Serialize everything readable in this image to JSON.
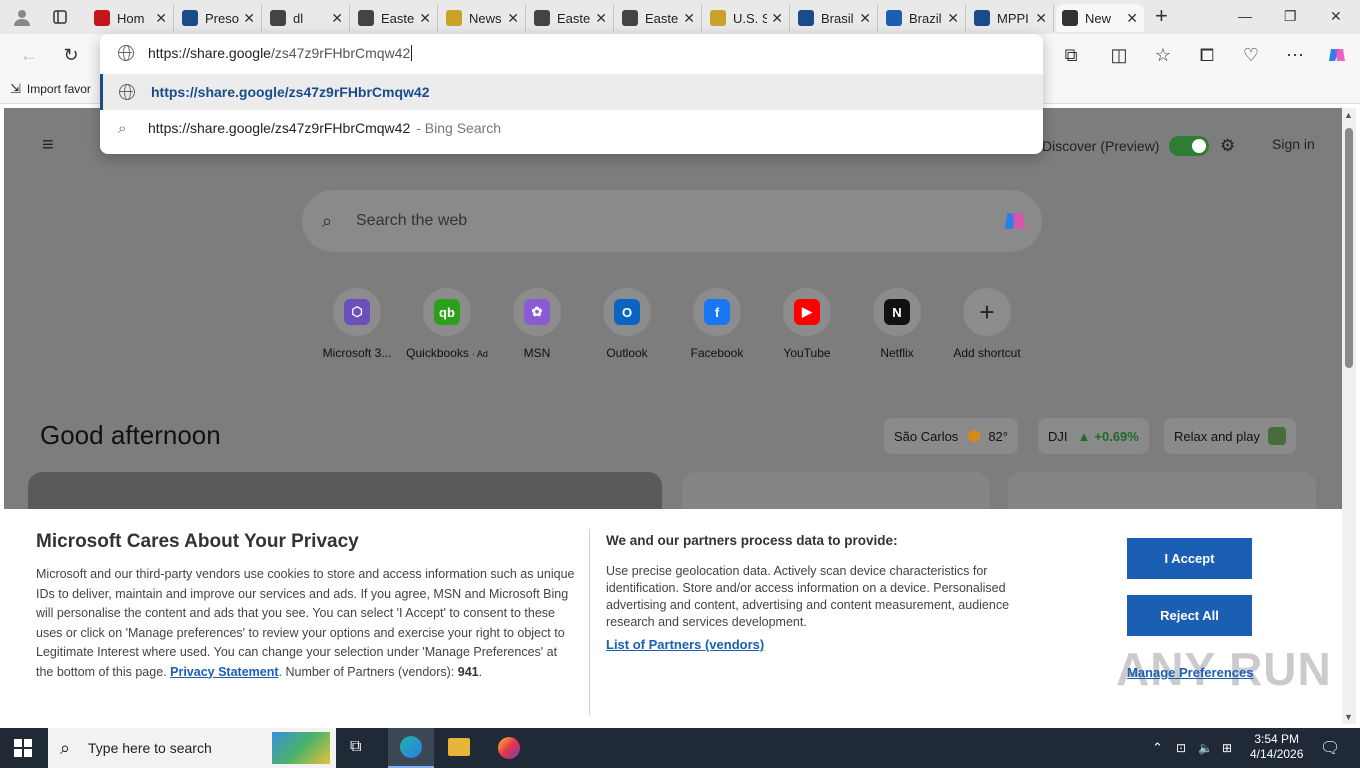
{
  "tabs": [
    {
      "label": "Hom",
      "favicon": "g1",
      "color": "#c4161c"
    },
    {
      "label": "Preso",
      "favicon": "news",
      "color": "#1a4c8a"
    },
    {
      "label": "dl",
      "favicon": "target",
      "color": "#444"
    },
    {
      "label": "Easte",
      "favicon": "target",
      "color": "#444"
    },
    {
      "label": "News",
      "favicon": "star",
      "color": "#c9a227"
    },
    {
      "label": "Easte",
      "favicon": "target",
      "color": "#444"
    },
    {
      "label": "Easte",
      "favicon": "target",
      "color": "#444"
    },
    {
      "label": "U.S. S",
      "favicon": "star",
      "color": "#c9a227"
    },
    {
      "label": "Brasil",
      "favicon": "GN",
      "color": "#1a4c8a"
    },
    {
      "label": "Brazil",
      "favicon": "dots",
      "color": "#1a5fb4"
    },
    {
      "label": "MPPI",
      "favicon": "news",
      "color": "#1a4c8a"
    },
    {
      "label": "New",
      "favicon": "newtab",
      "color": "#333",
      "active": true
    }
  ],
  "address": {
    "host": "https://share.google",
    "path": "/zs47z9rFHbrCmqw42"
  },
  "suggestions": [
    {
      "text": "https://share.google/zs47z9rFHbrCmqw42"
    },
    {
      "text": "https://share.google/zs47z9rFHbrCmqw42",
      "suffix": "- Bing Search"
    }
  ],
  "favorites_bar": {
    "import_label": "Import favor"
  },
  "msn": {
    "discover_label": "Discover (Preview)",
    "sign_in": "Sign in",
    "search_placeholder": "Search the web",
    "shortcuts": [
      {
        "label": "Microsoft 3...",
        "icon": "m365-icon",
        "color": "#6b4fbb",
        "glyph": "⬡"
      },
      {
        "label": "Quickbooks",
        "ad": "· Ad",
        "icon": "quickbooks-icon",
        "color": "#2ca01c",
        "glyph": "qb"
      },
      {
        "label": "MSN",
        "icon": "msn-icon",
        "color": "#8a5bd6",
        "glyph": "✿"
      },
      {
        "label": "Outlook",
        "icon": "outlook-icon",
        "color": "#0a64c2",
        "glyph": "O"
      },
      {
        "label": "Facebook",
        "icon": "facebook-icon",
        "color": "#1877f2",
        "glyph": "f"
      },
      {
        "label": "YouTube",
        "icon": "youtube-icon",
        "color": "#ff0000",
        "glyph": "▶"
      },
      {
        "label": "Netflix",
        "icon": "netflix-icon",
        "color": "#111",
        "glyph": "N"
      },
      {
        "label": "Add shortcut",
        "icon": "plus-icon",
        "color": "transparent",
        "glyph": "+"
      }
    ],
    "greeting": "Good afternoon",
    "weather": {
      "city": "São Carlos",
      "temp": "82°"
    },
    "stock": {
      "symbol": "DJI",
      "change": "+0.69%"
    },
    "relax": "Relax and play"
  },
  "privacy": {
    "title": "Microsoft Cares About Your Privacy",
    "body": "Microsoft and our third-party vendors use cookies to store and access information such as unique IDs to deliver, maintain and improve our services and ads. If you agree, MSN and Microsoft Bing will personalise the content and ads that you see. You can select 'I Accept' to consent to these uses or click on 'Manage preferences' to review your options and exercise your right to object to Legitimate Interest where used.  You can change your selection under 'Manage Preferences' at the bottom of this page.",
    "privacy_link": "Privacy Statement",
    "partners_prefix": "Number of Partners (vendors):",
    "partners_count": "941",
    "right_title": "We and our partners process data to provide:",
    "right_body": "Use precise geolocation data. Actively scan device characteristics for identification. Store and/or access information on a device. Personalised advertising and content, advertising and content measurement, audience research and services development.",
    "partners_link": "List of Partners (vendors)",
    "accept": "I Accept",
    "reject": "Reject All",
    "manage": "Manage Preferences"
  },
  "watermark": "ANY RUN",
  "taskbar": {
    "search_placeholder": "Type here to search",
    "time": "3:54 PM",
    "date": "4/14/2026"
  }
}
